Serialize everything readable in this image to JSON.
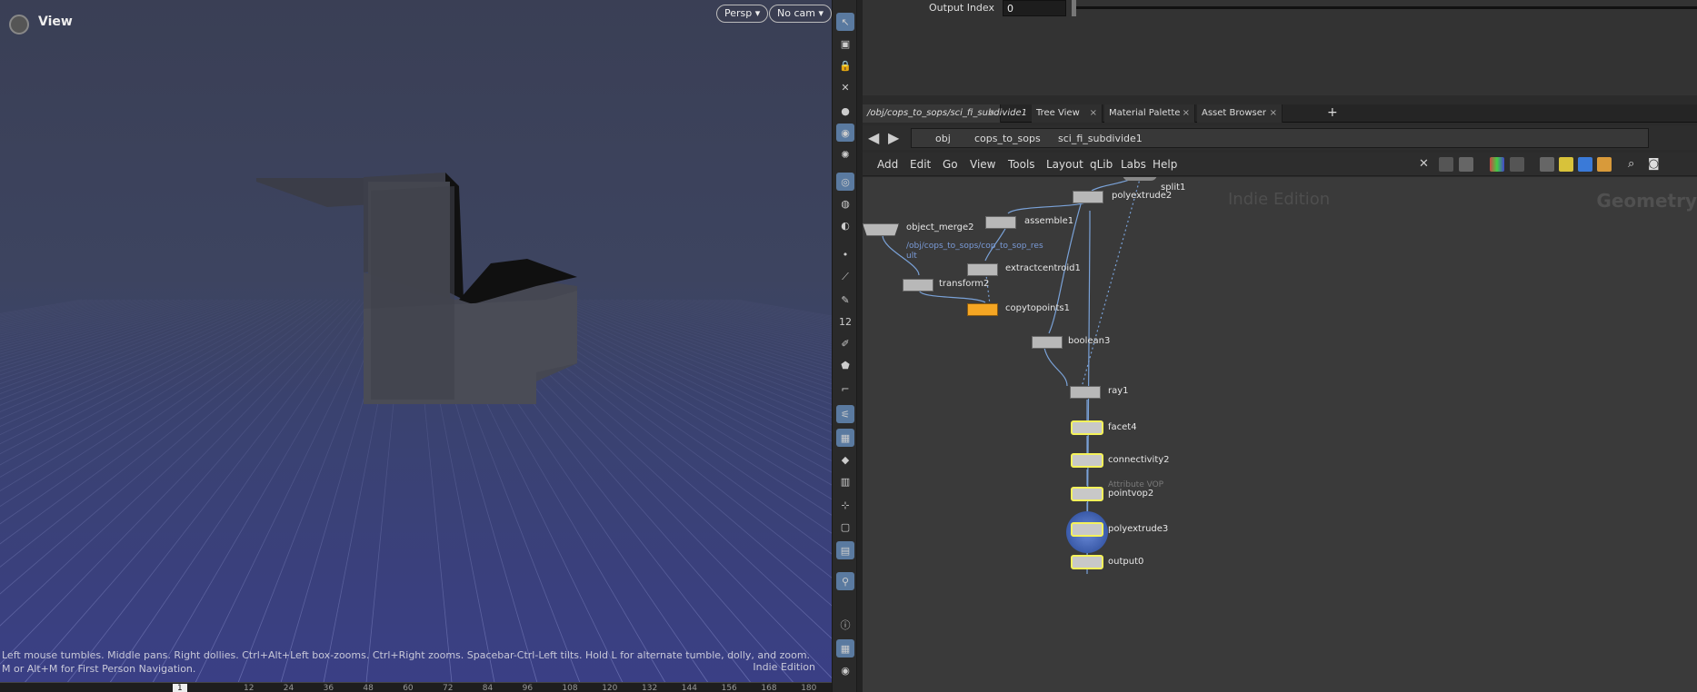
{
  "viewport": {
    "title": "View",
    "persp_button": "Persp ▾",
    "cam_button": "No cam ▾",
    "hint": "Left mouse tumbles. Middle pans. Right dollies. Ctrl+Alt+Left box-zooms. Ctrl+Right zooms. Spacebar-Ctrl-Left tilts. Hold L for alternate tumble, dolly, and zoom.   M or Alt+M for First Person Navigation.",
    "watermark": "Indie Edition",
    "timeline_frame": "1",
    "timeline_ticks": [
      "12",
      "24",
      "36",
      "48",
      "60",
      "72",
      "84",
      "96",
      "108",
      "120",
      "132",
      "144",
      "156",
      "168",
      "180",
      "1"
    ]
  },
  "parameters": {
    "label": "Output Index",
    "value": "0"
  },
  "tabs": [
    {
      "label": "/obj/cops_to_sops/sci_fi_subdivide1",
      "close": "×"
    },
    {
      "label": "Tree View",
      "close": "×"
    },
    {
      "label": "Material Palette",
      "close": "×"
    },
    {
      "label": "Asset Browser",
      "close": "×"
    }
  ],
  "tab_add": "+",
  "pathbar": {
    "back": "◀",
    "forward": "▶",
    "crumbs": [
      "obj",
      "cops_to_sops",
      "sci_fi_subdivide1"
    ]
  },
  "menu": [
    "Add",
    "Edit",
    "Go",
    "View",
    "Tools",
    "Layout",
    "qLib",
    "Labs",
    "Help"
  ],
  "network": {
    "watermark": "Indie Edition",
    "context": "Geometry",
    "nodes": {
      "split1": "split1",
      "polyextrude2": "polyextrude2",
      "assemble1": "assemble1",
      "object_merge2": "object_merge2",
      "object_merge2_path_1": "/obj/cops_to_sops/cop_to_sop_res",
      "object_merge2_path_2": "ult",
      "extractcentroid1": "extractcentroid1",
      "transform2": "transform2",
      "copytopoints1": "copytopoints1",
      "boolean3": "boolean3",
      "ray1": "ray1",
      "facet4": "facet4",
      "connectivity2": "connectivity2",
      "pointvop2": "pointvop2",
      "pointvop2_type": "Attribute VOP",
      "polyextrude3": "polyextrude3",
      "output0": "output0"
    }
  },
  "colors": {
    "node_selected": "#f5f25a",
    "node_orange": "#f5a623",
    "wire": "#7aa2d8",
    "background": "#3a3a3a"
  }
}
